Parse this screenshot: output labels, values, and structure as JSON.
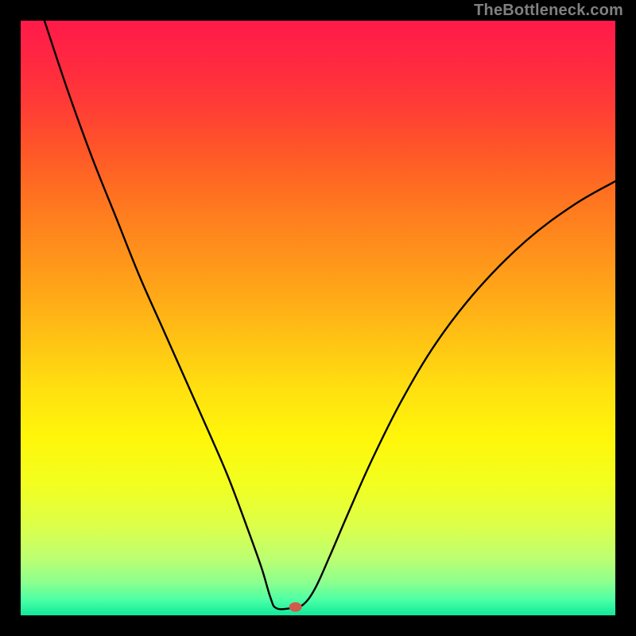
{
  "watermark": "TheBottleneck.com",
  "chart_data": {
    "type": "line",
    "title": "",
    "xlabel": "",
    "ylabel": "",
    "xlim": [
      0,
      100
    ],
    "ylim": [
      0,
      100
    ],
    "gradient_stops": [
      {
        "offset": 0.0,
        "color": "#ff1a4a"
      },
      {
        "offset": 0.06,
        "color": "#ff2642"
      },
      {
        "offset": 0.14,
        "color": "#ff3b36"
      },
      {
        "offset": 0.22,
        "color": "#ff5728"
      },
      {
        "offset": 0.3,
        "color": "#ff7420"
      },
      {
        "offset": 0.38,
        "color": "#ff8e1c"
      },
      {
        "offset": 0.46,
        "color": "#ffa818"
      },
      {
        "offset": 0.54,
        "color": "#ffc414"
      },
      {
        "offset": 0.62,
        "color": "#ffe010"
      },
      {
        "offset": 0.7,
        "color": "#fff60a"
      },
      {
        "offset": 0.78,
        "color": "#f2ff20"
      },
      {
        "offset": 0.85,
        "color": "#dcff4a"
      },
      {
        "offset": 0.905,
        "color": "#bcff72"
      },
      {
        "offset": 0.945,
        "color": "#8cff8e"
      },
      {
        "offset": 0.975,
        "color": "#4affa6"
      },
      {
        "offset": 1.0,
        "color": "#10e89a"
      }
    ],
    "series": [
      {
        "name": "bottleneck-curve",
        "color": "#000000",
        "points": [
          {
            "x": 4.0,
            "y": 100.0
          },
          {
            "x": 8.0,
            "y": 88.0
          },
          {
            "x": 12.0,
            "y": 77.0
          },
          {
            "x": 16.0,
            "y": 67.0
          },
          {
            "x": 20.0,
            "y": 57.0
          },
          {
            "x": 24.0,
            "y": 48.0
          },
          {
            "x": 28.0,
            "y": 39.0
          },
          {
            "x": 32.0,
            "y": 30.0
          },
          {
            "x": 35.0,
            "y": 23.0
          },
          {
            "x": 38.0,
            "y": 15.0
          },
          {
            "x": 40.5,
            "y": 8.0
          },
          {
            "x": 42.0,
            "y": 3.0
          },
          {
            "x": 43.0,
            "y": 1.2
          },
          {
            "x": 45.5,
            "y": 1.2
          },
          {
            "x": 47.5,
            "y": 1.8
          },
          {
            "x": 49.5,
            "y": 4.5
          },
          {
            "x": 52.0,
            "y": 10.0
          },
          {
            "x": 55.0,
            "y": 17.0
          },
          {
            "x": 59.0,
            "y": 26.0
          },
          {
            "x": 64.0,
            "y": 36.0
          },
          {
            "x": 70.0,
            "y": 46.0
          },
          {
            "x": 77.0,
            "y": 55.0
          },
          {
            "x": 85.0,
            "y": 63.0
          },
          {
            "x": 93.0,
            "y": 69.0
          },
          {
            "x": 100.0,
            "y": 73.0
          }
        ]
      }
    ],
    "marker": {
      "x": 46.2,
      "y": 1.4,
      "color": "#d15a4a",
      "rx": 8,
      "ry": 6
    }
  }
}
